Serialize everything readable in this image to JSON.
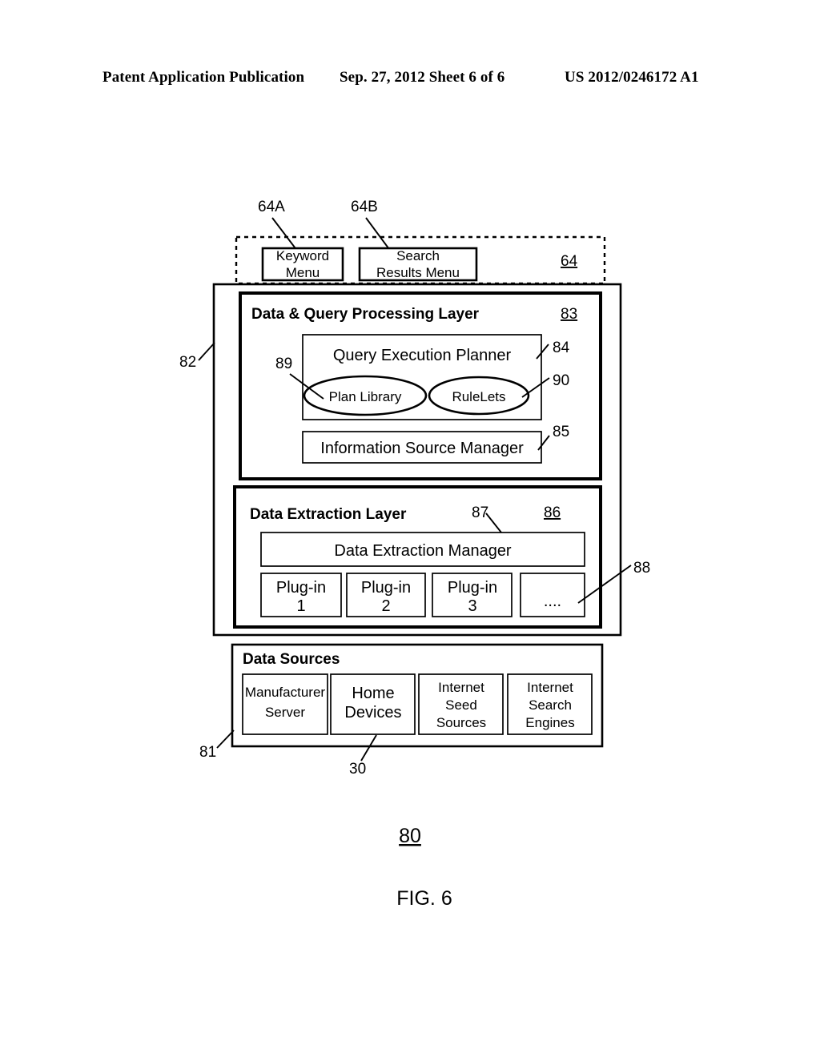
{
  "page_header": {
    "left": "Patent Application Publication",
    "middle": "Sep. 27, 2012  Sheet 6 of 6",
    "right": "US 2012/0246172 A1"
  },
  "figure": {
    "number_label": "80",
    "caption": "FIG. 6"
  },
  "menu_bar": {
    "ref": "64",
    "items": [
      {
        "label_line1": "Keyword",
        "label_line2": "Menu",
        "ref": "64A"
      },
      {
        "label_line1": "Search",
        "label_line2": "Results Menu",
        "ref": "64B"
      }
    ]
  },
  "system_box": {
    "ref": "82"
  },
  "query_layer": {
    "title": "Data & Query Processing Layer",
    "ref": "83",
    "planner": {
      "title": "Query Execution Planner",
      "ref": "84",
      "nodes": [
        {
          "label": "Plan Library",
          "ref": "89"
        },
        {
          "label": "RuleLets",
          "ref": "90"
        }
      ]
    },
    "source_manager": {
      "title": "Information Source Manager",
      "ref": "85"
    }
  },
  "extraction_layer": {
    "title": "Data Extraction Layer",
    "ref": "86",
    "manager": {
      "title": "Data Extraction Manager",
      "ref": "87"
    },
    "plugins_ref": "88",
    "plugins": [
      {
        "line1": "Plug-in",
        "line2": "1"
      },
      {
        "line1": "Plug-in",
        "line2": "2"
      },
      {
        "line1": "Plug-in",
        "line2": "3"
      },
      {
        "line1": "",
        "line2": "...."
      }
    ]
  },
  "data_sources": {
    "title": "Data Sources",
    "ref": "81",
    "home_devices_ref": "30",
    "items": [
      {
        "line1": "Manufacturer",
        "line2": "Server",
        "line3": ""
      },
      {
        "line1": "Home",
        "line2": "Devices",
        "line3": ""
      },
      {
        "line1": "Internet",
        "line2": "Seed",
        "line3": "Sources"
      },
      {
        "line1": "Internet",
        "line2": "Search",
        "line3": "Engines"
      }
    ]
  }
}
